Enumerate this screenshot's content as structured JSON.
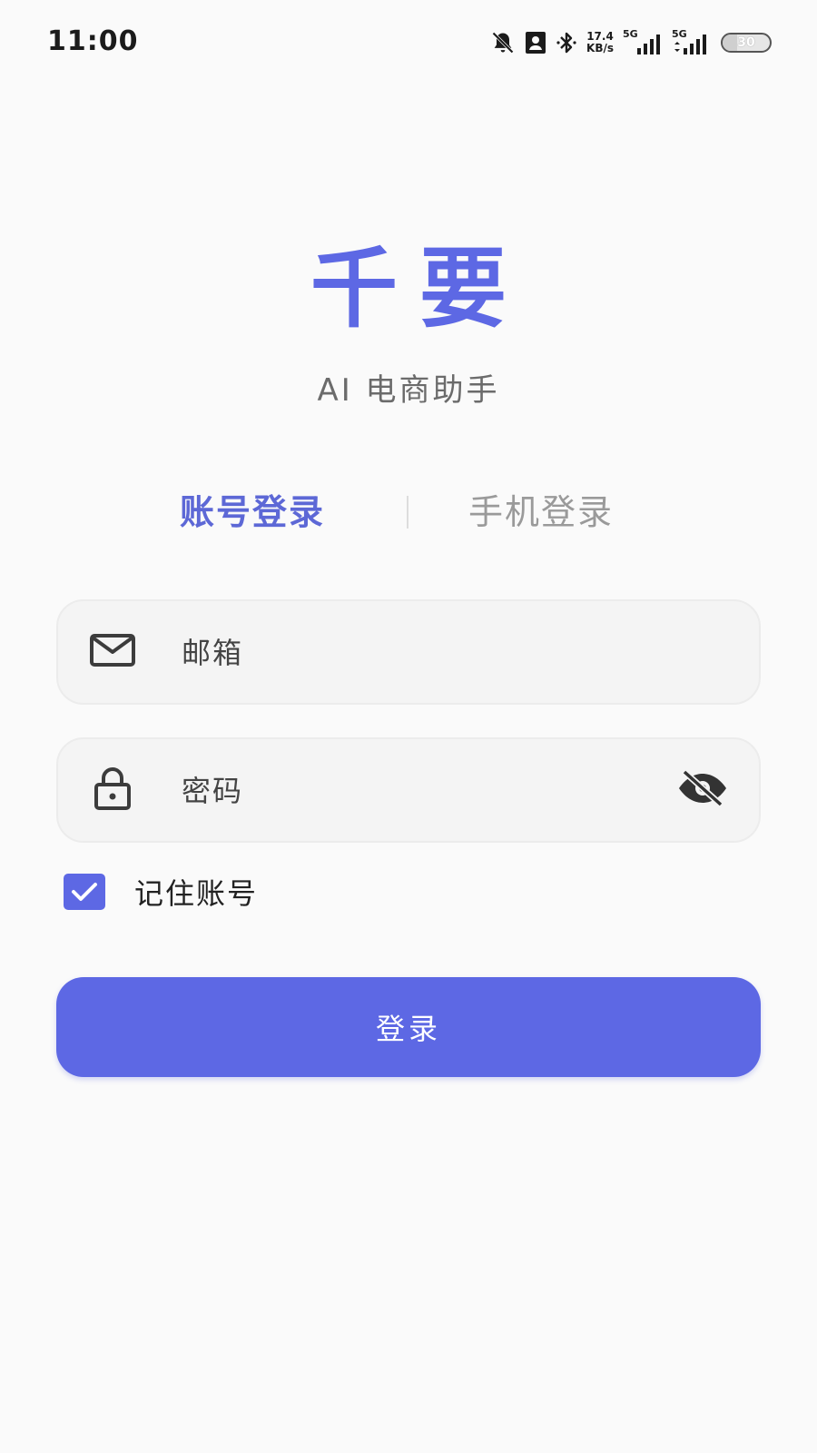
{
  "status_bar": {
    "time": "11:00",
    "net_speed_value": "17.4",
    "net_speed_unit": "KB/s",
    "sim1_label": "5G",
    "sim2_label": "5G",
    "battery_level": "30"
  },
  "brand": {
    "title": "千要",
    "subtitle": "AI 电商助手"
  },
  "tabs": [
    {
      "label": "账号登录",
      "active": true
    },
    {
      "label": "手机登录",
      "active": false
    }
  ],
  "form": {
    "email_placeholder": "邮箱",
    "email_value": "",
    "password_placeholder": "密码",
    "password_value": "",
    "remember_label": "记住账号",
    "remember_checked": true,
    "login_label": "登录"
  },
  "icons": {
    "email": "mail-icon",
    "password": "lock-icon",
    "visibility": "eye-off-icon",
    "checkbox": "check-icon"
  },
  "colors": {
    "accent": "#5d68e4",
    "background": "#fafafa",
    "field_background": "#f4f4f4"
  }
}
